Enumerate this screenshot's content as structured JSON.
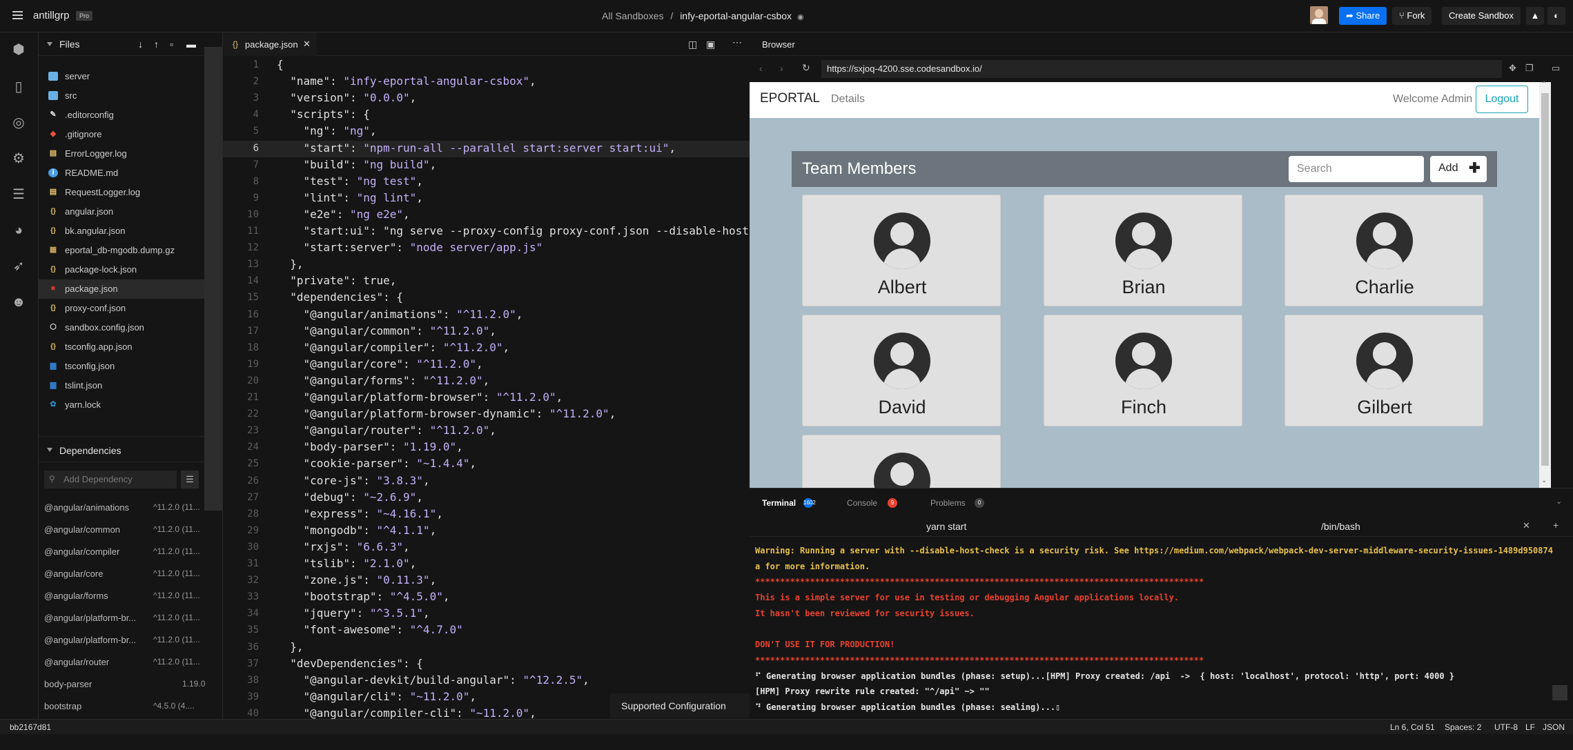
{
  "topbar": {
    "org": "antillgrp",
    "plan": "Pro",
    "crumb_parent": "All Sandboxes",
    "crumb_sep": "/",
    "sandbox_name": "infy-eportal-angular-csbox",
    "share": "Share",
    "fork": "Fork",
    "create": "Create Sandbox"
  },
  "files": {
    "title": "Files",
    "items": [
      {
        "name": "server",
        "icon": "folder-icon"
      },
      {
        "name": "src",
        "icon": "folder-icon"
      },
      {
        "name": ".editorconfig",
        "icon": "editorconfig-icon"
      },
      {
        "name": ".gitignore",
        "icon": "git-icon"
      },
      {
        "name": "ErrorLogger.log",
        "icon": "log-icon"
      },
      {
        "name": "README.md",
        "icon": "info-icon"
      },
      {
        "name": "RequestLogger.log",
        "icon": "log-icon"
      },
      {
        "name": "angular.json",
        "icon": "json-icon"
      },
      {
        "name": "bk.angular.json",
        "icon": "json-icon"
      },
      {
        "name": "eportal_db-mgodb.dump.gz",
        "icon": "archive-icon"
      },
      {
        "name": "package-lock.json",
        "icon": "json-icon"
      },
      {
        "name": "package.json",
        "icon": "npm-icon"
      },
      {
        "name": "proxy-conf.json",
        "icon": "json-icon"
      },
      {
        "name": "sandbox.config.json",
        "icon": "codesandbox-icon"
      },
      {
        "name": "tsconfig.app.json",
        "icon": "json-icon"
      },
      {
        "name": "tsconfig.json",
        "icon": "ts-icon"
      },
      {
        "name": "tslint.json",
        "icon": "ts-icon"
      },
      {
        "name": "yarn.lock",
        "icon": "yarn-icon"
      }
    ]
  },
  "deps": {
    "title": "Dependencies",
    "placeholder": "Add Dependency",
    "items": [
      {
        "name": "@angular/animations",
        "ver": "^11.2.0 (11..."
      },
      {
        "name": "@angular/common",
        "ver": "^11.2.0 (11..."
      },
      {
        "name": "@angular/compiler",
        "ver": "^11.2.0 (11..."
      },
      {
        "name": "@angular/core",
        "ver": "^11.2.0 (11..."
      },
      {
        "name": "@angular/forms",
        "ver": "^11.2.0 (11..."
      },
      {
        "name": "@angular/platform-br...",
        "ver": "^11.2.0 (11..."
      },
      {
        "name": "@angular/platform-br...",
        "ver": "^11.2.0 (11..."
      },
      {
        "name": "@angular/router",
        "ver": "^11.2.0 (11..."
      },
      {
        "name": "body-parser",
        "ver": "1.19.0"
      },
      {
        "name": "bootstrap",
        "ver": "^4.5.0 (4...."
      }
    ]
  },
  "editor": {
    "tab": "package.json",
    "lines": [
      "{",
      "  \"name\": \"infy-eportal-angular-csbox\",",
      "  \"version\": \"0.0.0\",",
      "  \"scripts\": {",
      "    \"ng\": \"ng\",",
      "    \"start\": \"npm-run-all --parallel start:server start:ui\",",
      "    \"build\": \"ng build\",",
      "    \"test\": \"ng test\",",
      "    \"lint\": \"ng lint\",",
      "    \"e2e\": \"ng e2e\",",
      "    \"start:ui\": \"ng serve --proxy-config proxy-conf.json --disable-host",
      "    \"start:server\": \"node server/app.js\"",
      "  },",
      "  \"private\": true,",
      "  \"dependencies\": {",
      "    \"@angular/animations\": \"^11.2.0\",",
      "    \"@angular/common\": \"^11.2.0\",",
      "    \"@angular/compiler\": \"^11.2.0\",",
      "    \"@angular/core\": \"^11.2.0\",",
      "    \"@angular/forms\": \"^11.2.0\",",
      "    \"@angular/platform-browser\": \"^11.2.0\",",
      "    \"@angular/platform-browser-dynamic\": \"^11.2.0\",",
      "    \"@angular/router\": \"^11.2.0\",",
      "    \"body-parser\": \"1.19.0\",",
      "    \"cookie-parser\": \"~1.4.4\",",
      "    \"core-js\": \"3.8.3\",",
      "    \"debug\": \"~2.6.9\",",
      "    \"express\": \"~4.16.1\",",
      "    \"mongodb\": \"^4.1.1\",",
      "    \"rxjs\": \"6.6.3\",",
      "    \"tslib\": \"2.1.0\",",
      "    \"zone.js\": \"0.11.3\",",
      "    \"bootstrap\": \"^4.5.0\",",
      "    \"jquery\": \"^3.5.1\",",
      "    \"font-awesome\": \"^4.7.0\"",
      "  },",
      "  \"devDependencies\": {",
      "    \"@angular-devkit/build-angular\": \"^12.2.5\",",
      "    \"@angular/cli\": \"~11.2.0\",",
      "    \"@angular/compiler-cli\": \"~11.2.0\","
    ],
    "current_line": 6,
    "supported_config": "Supported Configuration"
  },
  "browser": {
    "title": "Browser",
    "url": "https://sxjoq-4200.sse.codesandbox.io/",
    "app": {
      "brand": "EPORTAL",
      "nav_details": "Details",
      "welcome": "Welcome Admin",
      "logout": "Logout",
      "team_title": "Team Members",
      "search_placeholder": "Search",
      "add": "Add",
      "members": [
        "Albert",
        "Brian",
        "Charlie",
        "David",
        "Finch",
        "Gilbert",
        ""
      ]
    }
  },
  "terminal": {
    "tabs": [
      {
        "label": "Terminal",
        "badge": "1602"
      },
      {
        "label": "Console",
        "badge": "9"
      },
      {
        "label": "Problems",
        "badge": "0"
      }
    ],
    "sessions": [
      "yarn start",
      "/bin/bash"
    ],
    "lines": [
      {
        "text": "Warning: Running a server with --disable-host-check is a security risk. See https://medium.com/webpack/webpack-dev-server-middleware-security-issues-1489d950874",
        "c": "y"
      },
      {
        "text": "a for more information.",
        "c": "y"
      },
      {
        "text": "******************************************************************************************",
        "c": "r"
      },
      {
        "text": "This is a simple server for use in testing or debugging Angular applications locally.",
        "c": "r"
      },
      {
        "text": "It hasn't been reviewed for security issues.",
        "c": "r"
      },
      {
        "text": "",
        "c": "r"
      },
      {
        "text": "DON'T USE IT FOR PRODUCTION!",
        "c": "r"
      },
      {
        "text": "******************************************************************************************",
        "c": "r"
      },
      {
        "text": "⠋ Generating browser application bundles (phase: setup)...[HPM] Proxy created: /api  ->  { host: 'localhost', protocol: 'http', port: 4000 }",
        "c": "w"
      },
      {
        "text": "[HPM] Proxy rewrite rule created: \"^/api\" ~> \"\"",
        "c": "w"
      },
      {
        "text": "⠙ Generating browser application bundles (phase: sealing)...▯",
        "c": "w"
      }
    ]
  },
  "status": {
    "commit": "bb2167d81",
    "position": "Ln 6, Col 51",
    "spaces": "Spaces: 2",
    "encoding": "UTF-8",
    "eol": "LF",
    "lang": "JSON"
  }
}
